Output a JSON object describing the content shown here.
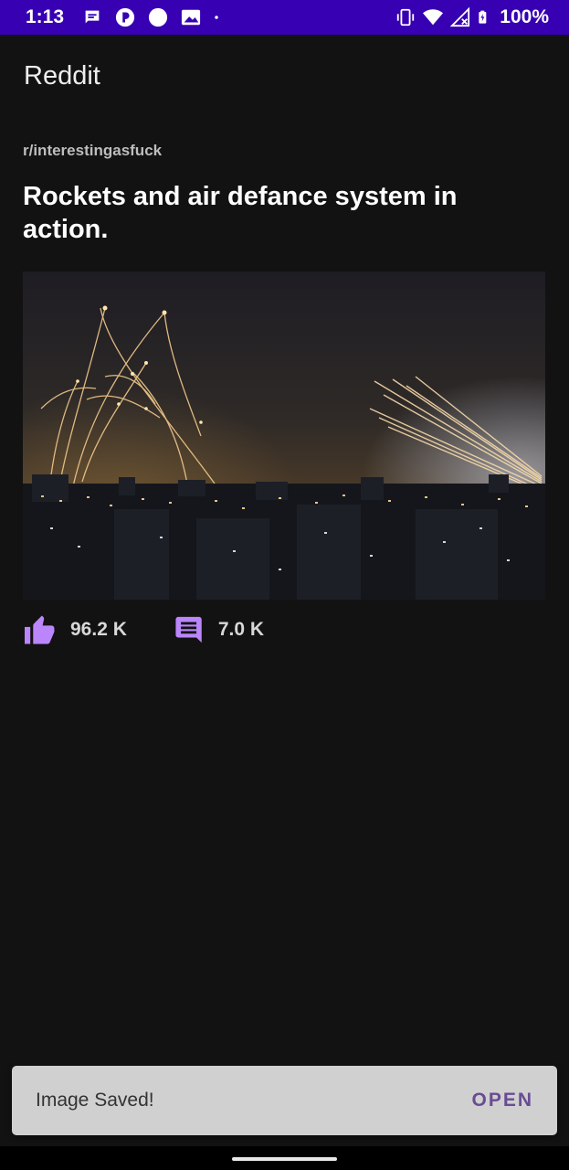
{
  "status_bar": {
    "time": "1:13",
    "battery": "100%",
    "left_icons": [
      "message-icon",
      "p-app-icon",
      "circle-icon",
      "image-icon",
      "dot-icon"
    ],
    "right_icons": [
      "vibrate-icon",
      "wifi-icon",
      "no-signal-icon",
      "battery-charging-icon"
    ]
  },
  "app_bar": {
    "title": "Reddit"
  },
  "post": {
    "subreddit": "r/interestingasfuck",
    "title": "Rockets and air defance system in action.",
    "likes": "96.2 K",
    "comments": "7.0 K"
  },
  "snackbar": {
    "message": "Image Saved!",
    "action": "OPEN"
  },
  "colors": {
    "status_bar": "#3700b3",
    "background": "#121212",
    "accent": "#bb86fc",
    "snackbar_bg": "#d0d0d0",
    "snackbar_action": "#6a4c93"
  }
}
